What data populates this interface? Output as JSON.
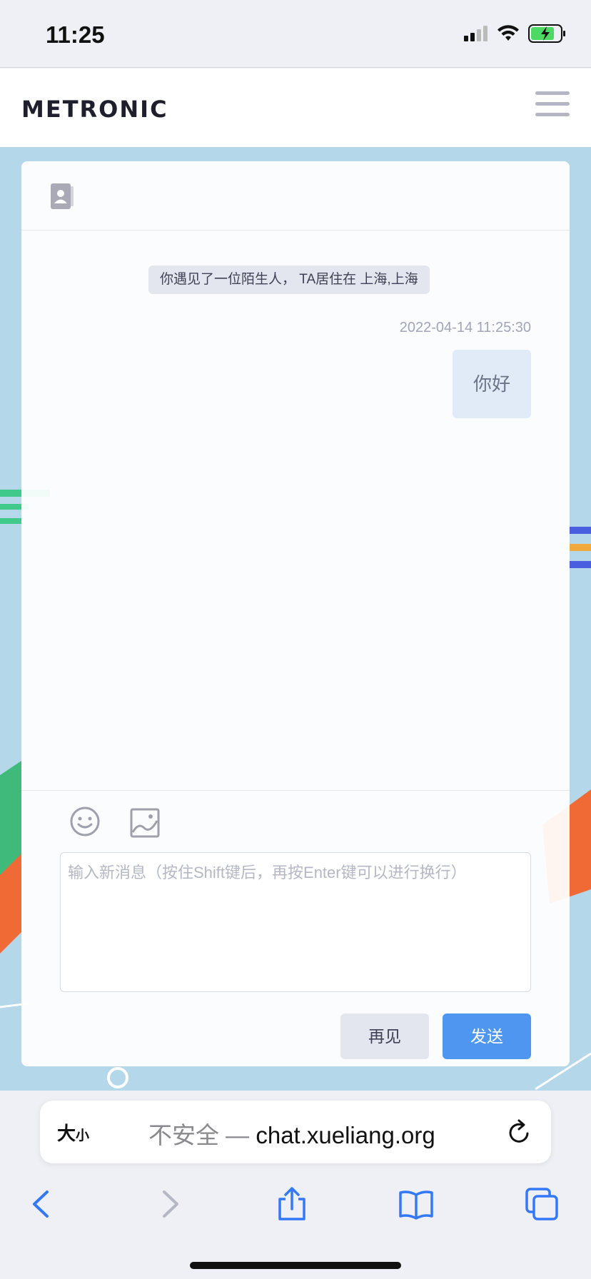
{
  "status_bar": {
    "time": "11:25"
  },
  "header": {
    "logo": "METRONIC",
    "menu_icon": "hamburger-menu-icon"
  },
  "chat": {
    "contact_icon": "contact-card-icon",
    "system_notice": "你遇见了一位陌生人， TA居住在 上海,上海",
    "messages": [
      {
        "time": "2022-04-14 11:25:30",
        "text": "你好",
        "side": "right"
      }
    ],
    "toolbar": {
      "emoji_icon": "emoji-icon",
      "image_icon": "image-icon"
    },
    "input": {
      "value": "",
      "placeholder": "输入新消息（按住Shift键后，再按Enter键可以进行换行）"
    },
    "buttons": {
      "bye": "再见",
      "send": "发送"
    }
  },
  "browser": {
    "text_size_big": "大",
    "text_size_small": "小",
    "security_label": "不安全 —",
    "domain": "chat.xueliang.org",
    "nav": [
      "back-icon",
      "forward-icon",
      "share-icon",
      "bookmarks-icon",
      "tabs-icon"
    ]
  },
  "colors": {
    "accent": "#4f96f0",
    "background": "#b4d7e9",
    "bubble": "#e1ebf8"
  }
}
